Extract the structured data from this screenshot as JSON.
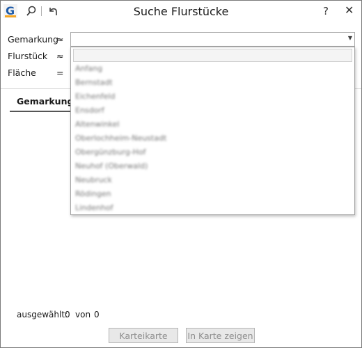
{
  "window": {
    "title": "Suche Flurstücke",
    "help_label": "?",
    "close_label": "✕"
  },
  "toolbar": {
    "logo_letter": "G"
  },
  "form": {
    "rows": [
      {
        "label": "Gemarkung",
        "op": "≈"
      },
      {
        "label": "Flurstück",
        "op": "≈"
      },
      {
        "label": "Fläche",
        "op": "="
      }
    ],
    "combo_value": ""
  },
  "dropdown": {
    "options": [
      "Anfang",
      "Bernstadt",
      "Eichenfeld",
      "Ensdorf",
      "Altenwinkel",
      "Oberlochheim-Neustadt",
      "Obergünzburg-Hof",
      "Neuhof (Oberwald)",
      "Neubruck",
      "Rödingen",
      "Lindenhof"
    ]
  },
  "tabs": [
    {
      "label": "Gemarkung"
    }
  ],
  "status": {
    "selected_label": "ausgewählt:",
    "selected_count": "0",
    "of_label": "von",
    "total_count": "0"
  },
  "buttons": {
    "karteikarte": "Karteikarte",
    "show_on_map": "In Karte zeigen"
  }
}
